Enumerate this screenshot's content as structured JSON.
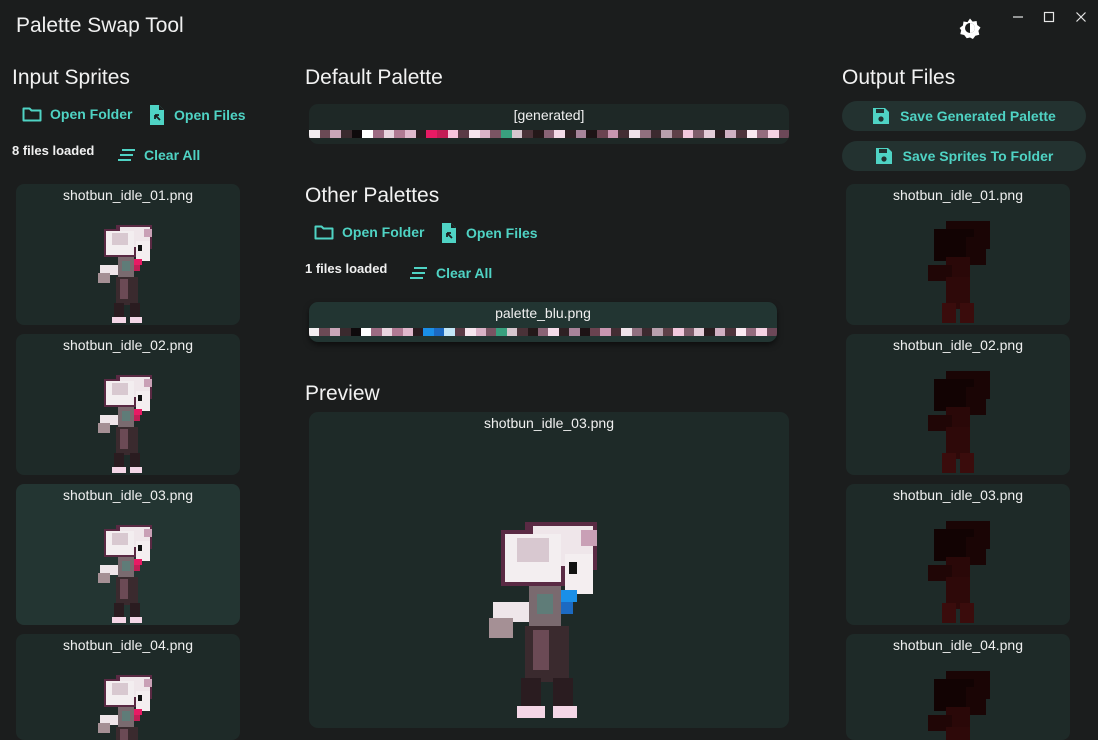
{
  "window": {
    "title": "Palette Swap Tool"
  },
  "input": {
    "title": "Input Sprites",
    "open_folder": "Open Folder",
    "open_files": "Open Files",
    "count": "8 files loaded",
    "clear_all": "Clear All",
    "files": [
      "shotbun_idle_01.png",
      "shotbun_idle_02.png",
      "shotbun_idle_03.png",
      "shotbun_idle_04.png"
    ],
    "selected_index": 2
  },
  "default_palette": {
    "title": "Default Palette",
    "name": "[generated]",
    "colors": [
      "#f2eef0",
      "#6b4a55",
      "#c9a6b8",
      "#3a2a2e",
      "#0e0a0c",
      "#ffffff",
      "#9c6b82",
      "#e8d5df",
      "#b07a93",
      "#e0b8cc",
      "#2a1c20",
      "#e81a64",
      "#c21c55",
      "#f7c3db",
      "#5a3a45",
      "#f6e6ee",
      "#d9b2c6",
      "#7a5463",
      "#39a07e",
      "#d6c6ce",
      "#4a3238",
      "#241819",
      "#8a6375",
      "#f4dbe8",
      "#2e2023",
      "#a8849a",
      "#1d1315",
      "#6a4350",
      "#c896b0",
      "#432d33",
      "#efe3ea",
      "#90707f",
      "#3c2a2f",
      "#b8a0ad",
      "#5e4048",
      "#f2c8dd",
      "#7e5c6a",
      "#e4ccd8",
      "#2a1d20",
      "#d0b0c2",
      "#4e343c",
      "#fbeaf2",
      "#946c7e",
      "#f5d2e3",
      "#6c4858"
    ]
  },
  "other_palettes": {
    "title": "Other Palettes",
    "open_folder": "Open Folder",
    "open_files": "Open Files",
    "count": "1 files loaded",
    "clear_all": "Clear All",
    "items": [
      {
        "name": "palette_blu.png",
        "colors": [
          "#f2eef0",
          "#6b4a55",
          "#c9a6b8",
          "#3a2a2e",
          "#0e0a0c",
          "#ffffff",
          "#9c6b82",
          "#e8d5df",
          "#b07a93",
          "#e0b8cc",
          "#2a1c20",
          "#1a8fe8",
          "#1c6ac2",
          "#c3e6f7",
          "#5a3a45",
          "#f6e6ee",
          "#d9b2c6",
          "#7a5463",
          "#39a07e",
          "#d6c6ce",
          "#4a3238",
          "#241819",
          "#8a6375",
          "#f4dbe8",
          "#2e2023",
          "#a8849a",
          "#1d1315",
          "#6a4350",
          "#c896b0",
          "#432d33",
          "#efe3ea",
          "#90707f",
          "#3c2a2f",
          "#b8a0ad",
          "#5e4048",
          "#f2c8dd",
          "#7e5c6a",
          "#e4ccd8",
          "#2a1d20",
          "#d0b0c2",
          "#4e343c",
          "#fbeaf2",
          "#946c7e",
          "#f5d2e3",
          "#6c4858"
        ]
      }
    ]
  },
  "preview": {
    "title": "Preview",
    "file": "shotbun_idle_03.png"
  },
  "output": {
    "title": "Output Files",
    "save_palette": "Save Generated Palette",
    "save_sprites": "Save Sprites To Folder",
    "files": [
      "shotbun_idle_01.png",
      "shotbun_idle_02.png",
      "shotbun_idle_03.png",
      "shotbun_idle_04.png"
    ]
  },
  "colors": {
    "accent": "#4fd3c4",
    "bg": "#1b1d1d",
    "card": "#1e2a28",
    "pill": "#233230"
  },
  "icons": {
    "folder": "folder-icon",
    "file": "file-import-icon",
    "clear": "clear-all-icon",
    "save": "save-icon",
    "theme": "brightness-icon"
  }
}
